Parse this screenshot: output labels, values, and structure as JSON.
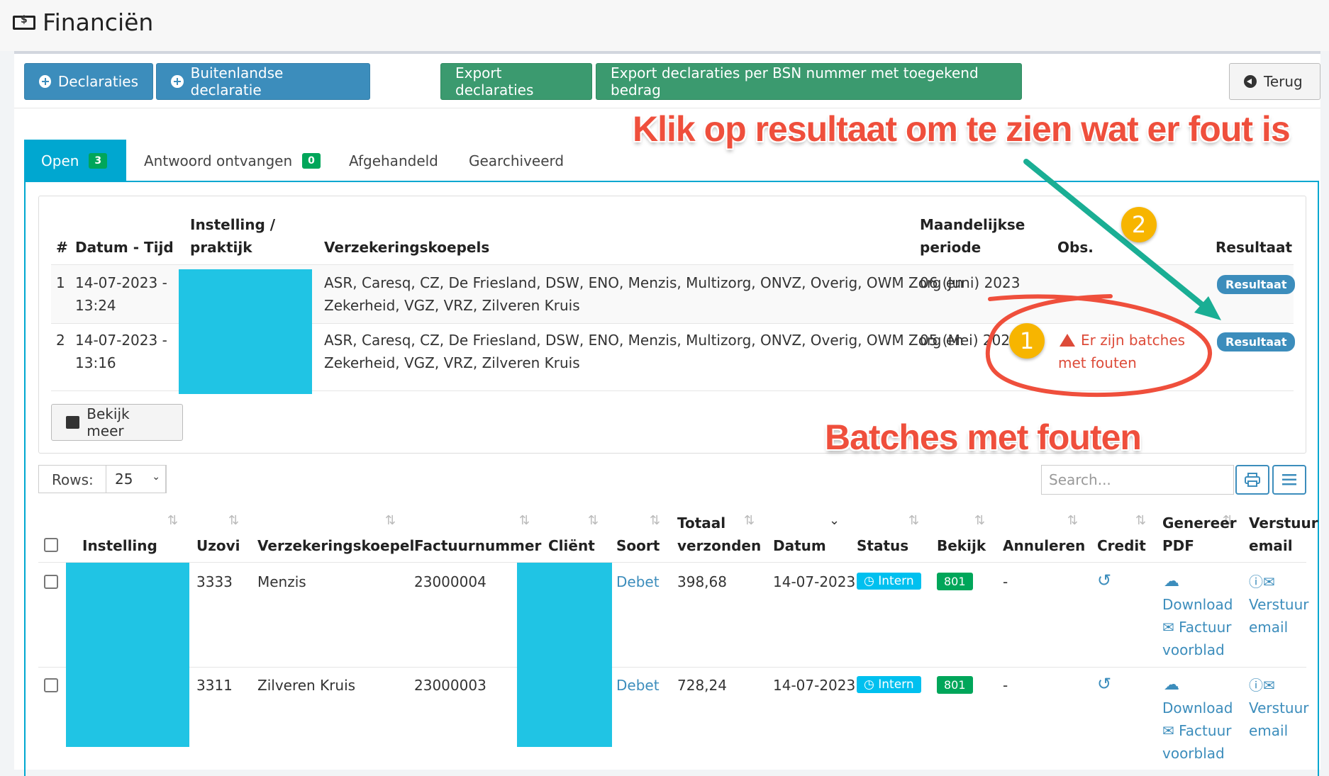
{
  "header": {
    "title": "Financiën"
  },
  "toolbar": {
    "declaraties": "Declaraties",
    "buitenlandse": "Buitenlandse declaratie",
    "export": "Export declaraties",
    "export_bsn": "Export declaraties per BSN nummer met toegekend bedrag",
    "terug": "Terug"
  },
  "tabs": [
    {
      "label": "Open",
      "count": "3"
    },
    {
      "label": "Antwoord ontvangen",
      "count": "0"
    },
    {
      "label": "Afgehandeld"
    },
    {
      "label": "Gearchiveerd"
    }
  ],
  "batch_table": {
    "headers": {
      "num": "#",
      "datum": "Datum - Tijd",
      "inst1": "Instelling /",
      "inst2": "praktijk",
      "koepels": "Verzekeringskoepels",
      "maand1": "Maandelijkse",
      "maand2": "periode",
      "obs": "Obs.",
      "resultaat": "Resultaat"
    },
    "rows": [
      {
        "num": "1",
        "datum1": "14-07-2023 -",
        "datum2": "13:24",
        "koepels1": "ASR, Caresq, CZ, De Friesland, DSW, ENO, Menzis, Multizorg, ONVZ, Overig, OWM Zorg en",
        "koepels2": "Zekerheid, VGZ, VRZ, Zilveren Kruis",
        "periode": "06 (Juni) 2023",
        "resultaat": "Resultaat"
      },
      {
        "num": "2",
        "datum1": "14-07-2023 -",
        "datum2": "13:16",
        "koepels1": "ASR, Caresq, CZ, De Friesland, DSW, ENO, Menzis, Multizorg, ONVZ, Overig, OWM Zorg en",
        "koepels2": "Zekerheid, VGZ, VRZ, Zilveren Kruis",
        "periode": "05 (Mei) 2023",
        "obs1": "Er zijn batches",
        "obs2": "met fouten",
        "resultaat": "Resultaat"
      }
    ],
    "bekijk_meer": "Bekijk meer"
  },
  "controls": {
    "rows_label": "Rows:",
    "rows_value": "25",
    "search_placeholder": "Search..."
  },
  "main_table": {
    "headers": {
      "instelling": "Instelling",
      "uzovi": "Uzovi",
      "koepel": "Verzekeringskoepel",
      "factuur": "Factuurnummer",
      "client": "Cliënt",
      "soort": "Soort",
      "totaal1": "Totaal",
      "totaal2": "verzonden",
      "datum": "Datum",
      "status": "Status",
      "bekijk": "Bekijk",
      "annuleren": "Annuleren",
      "credit": "Credit",
      "genereer1": "Genereer",
      "genereer2": "PDF",
      "verstuur1": "Verstuur",
      "verstuur2": "email"
    },
    "rows": [
      {
        "uzovi": "3333",
        "koepel": "Menzis",
        "factuur": "23000004",
        "soort": "Debet",
        "totaal": "398,68",
        "datum": "14-07-2023",
        "status": "Intern",
        "bekijk": "801",
        "annuleren": "-",
        "download": "Download",
        "factuur_vb1": "Factuur",
        "factuur_vb2": "voorblad",
        "verstuur1": "Verstuur",
        "verstuur2": "email"
      },
      {
        "uzovi": "3311",
        "koepel": "Zilveren Kruis",
        "factuur": "23000003",
        "soort": "Debet",
        "totaal": "728,24",
        "datum": "14-07-2023",
        "status": "Intern",
        "bekijk": "801",
        "annuleren": "-",
        "download": "Download",
        "factuur_vb1": "Factuur",
        "factuur_vb2": "voorblad",
        "verstuur1": "Verstuur",
        "verstuur2": "email"
      }
    ]
  },
  "annotations": {
    "top": "Klik op resultaat om te zien wat er fout is",
    "bottom": "Batches met fouten",
    "step1": "1",
    "step2": "2"
  },
  "colors": {
    "accent": "#00a7d0",
    "primary": "#3c8dbc",
    "success": "#3b9a6f",
    "danger": "#dd4b39",
    "redacted": "#20c4e4",
    "annotation": "#ef4f3c",
    "marker": "#f7b500",
    "arrow": "#1aae94"
  }
}
